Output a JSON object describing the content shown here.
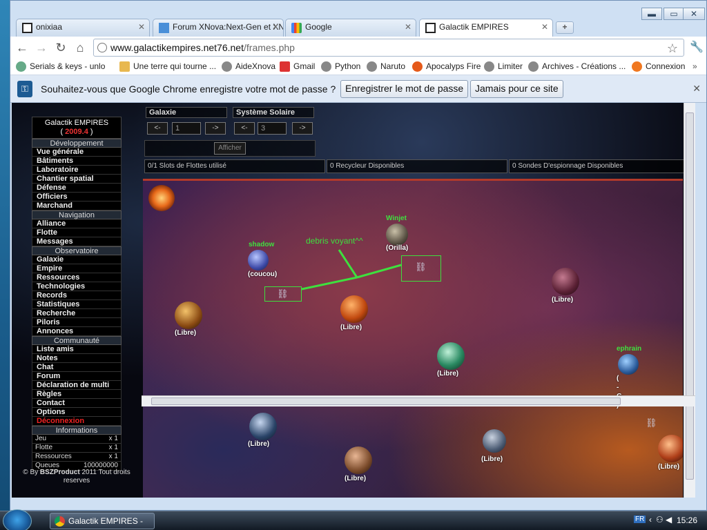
{
  "browser": {
    "tabs": [
      {
        "label": "onixiaa",
        "icon": "xnova-icon"
      },
      {
        "label": "Forum XNova:Next-Gen et XNova",
        "icon": "forum-icon"
      },
      {
        "label": "Google",
        "icon": "google-icon"
      },
      {
        "label": "Galactik EMPIRES",
        "icon": "xnova-icon"
      }
    ],
    "url_host": "www.galactikempires.net76.net",
    "url_path": "/frames.php",
    "bookmarks": [
      "Serials & keys - unlo",
      "Une terre qui tourne ...",
      "AideXnova",
      "Gmail",
      "Python",
      "Naruto",
      "Apocalyps Fire",
      "Limiter",
      "Archives - Créations ...",
      "Connexion"
    ],
    "infobar": {
      "message": "Souhaitez-vous que Google Chrome enregistre votre mot de passe ?",
      "save_button": "Enregistrer le mot de passe",
      "never_button": "Jamais pour ce site"
    },
    "window_controls": {
      "minimize": "▬",
      "maximize": "▭",
      "close": "✕"
    }
  },
  "menu": {
    "title": "Galactik EMPIRES",
    "version": "2009.4",
    "sections": [
      {
        "label": "Développement",
        "items": [
          "Vue générale",
          "Bâtiments",
          "Laboratoire",
          "Chantier spatial",
          "Défense",
          "Officiers",
          "Marchand"
        ]
      },
      {
        "label": "Navigation",
        "items": [
          "Alliance",
          "Flotte",
          "Messages"
        ]
      },
      {
        "label": "Observatoire",
        "items": [
          "Galaxie",
          "Empire",
          "Ressources",
          "Technologies",
          "Records",
          "Statistiques",
          "Recherche",
          "Piloris",
          "Annonces"
        ]
      },
      {
        "label": "Communauté",
        "items": [
          "Liste amis",
          "Notes",
          "Chat",
          "Forum",
          "Déclaration de multi",
          "Règles",
          "Contact",
          "Options",
          "Déconnexion"
        ]
      }
    ],
    "info_title": "Informations",
    "info": [
      {
        "k": "Jeu",
        "v": "x 1"
      },
      {
        "k": "Flotte",
        "v": "x 1"
      },
      {
        "k": "Ressources",
        "v": "x 1"
      },
      {
        "k": "Queues",
        "v": "100000000"
      }
    ],
    "copyright_pre": "© By ",
    "copyright_brand": "BSZProduct",
    "copyright_post": " 2011 Tout droits reserves"
  },
  "galaxy_nav": {
    "galaxy_label": "Galaxie",
    "system_label": "Système Solaire",
    "prev": "<-",
    "next": "->",
    "galaxy_value": "1",
    "system_value": "3",
    "show_button": "Afficher"
  },
  "stats": {
    "fleets": "0/1 Slots de Flottes utilisé",
    "recyclers": "0 Recycleur Disponibles",
    "probes": "0 Sondes D'espionnage Disponibles"
  },
  "map": {
    "annotation": "debris voyant^^",
    "planets": [
      {
        "owner": "Winjet",
        "label": "(Orilla)"
      },
      {
        "owner": "shadow",
        "label": "(coucou)"
      },
      {
        "owner": "",
        "label": "(Libre)"
      },
      {
        "owner": "",
        "label": "(Libre)"
      },
      {
        "owner": "",
        "label": "(Libre)"
      },
      {
        "owner": "",
        "label": "(Libre)"
      },
      {
        "owner": "ephrain",
        "label": "(\n-\nG-\n)"
      },
      {
        "owner": "",
        "label": "(Libre)"
      },
      {
        "owner": "",
        "label": "(Libre)"
      },
      {
        "owner": "",
        "label": "(Libre)"
      },
      {
        "owner": "",
        "label": "(Libre)"
      }
    ]
  },
  "taskbar": {
    "window": "Galactik EMPIRES - Go...",
    "lang": "FR",
    "time": "15:26"
  },
  "colors": {
    "name_green": "#3fe03f",
    "version_red": "#e33333",
    "logout_red": "#e22222"
  }
}
